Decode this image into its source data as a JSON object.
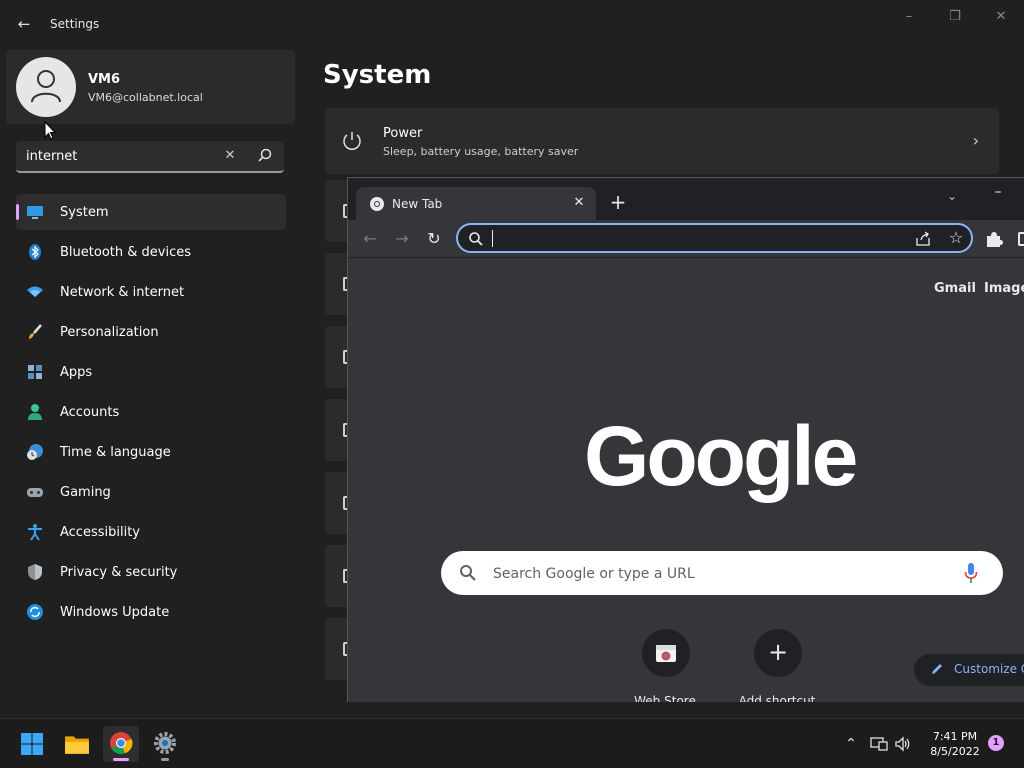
{
  "settings": {
    "title": "Settings",
    "profile": {
      "name": "VM6",
      "email": "VM6@collabnet.local"
    },
    "search": {
      "value": "internet"
    },
    "nav": [
      {
        "label": "System",
        "icon": "monitor-icon",
        "active": true
      },
      {
        "label": "Bluetooth & devices",
        "icon": "bluetooth-icon"
      },
      {
        "label": "Network & internet",
        "icon": "wifi-icon"
      },
      {
        "label": "Personalization",
        "icon": "brush-icon"
      },
      {
        "label": "Apps",
        "icon": "apps-icon"
      },
      {
        "label": "Accounts",
        "icon": "person-icon"
      },
      {
        "label": "Time & language",
        "icon": "clock-globe-icon"
      },
      {
        "label": "Gaming",
        "icon": "gamepad-icon"
      },
      {
        "label": "Accessibility",
        "icon": "accessibility-icon"
      },
      {
        "label": "Privacy & security",
        "icon": "shield-icon"
      },
      {
        "label": "Windows Update",
        "icon": "update-icon"
      }
    ],
    "page_title": "System",
    "cards": [
      {
        "title": "Power",
        "subtitle": "Sleep, battery usage, battery saver",
        "icon": "power-icon"
      }
    ]
  },
  "chrome": {
    "tab": {
      "title": "New Tab"
    },
    "ntp": {
      "links": [
        "Gmail",
        "Images"
      ],
      "logo": "Google",
      "search_placeholder": "Search Google or type a URL",
      "shortcuts": [
        {
          "label": "Web Store",
          "icon": "web-store-icon"
        },
        {
          "label": "Add shortcut",
          "icon": "plus-icon"
        }
      ],
      "customize_label": "Customize Chrome"
    }
  },
  "taskbar": {
    "apps": [
      "start-icon",
      "file-explorer-icon",
      "chrome-icon",
      "settings-gear-icon"
    ],
    "time": "7:41 PM",
    "date": "8/5/2022",
    "notification_count": "1"
  },
  "colors": {
    "accent": "#e3a0ff",
    "chrome_focus": "#8ab4f8",
    "background": "#202020"
  }
}
